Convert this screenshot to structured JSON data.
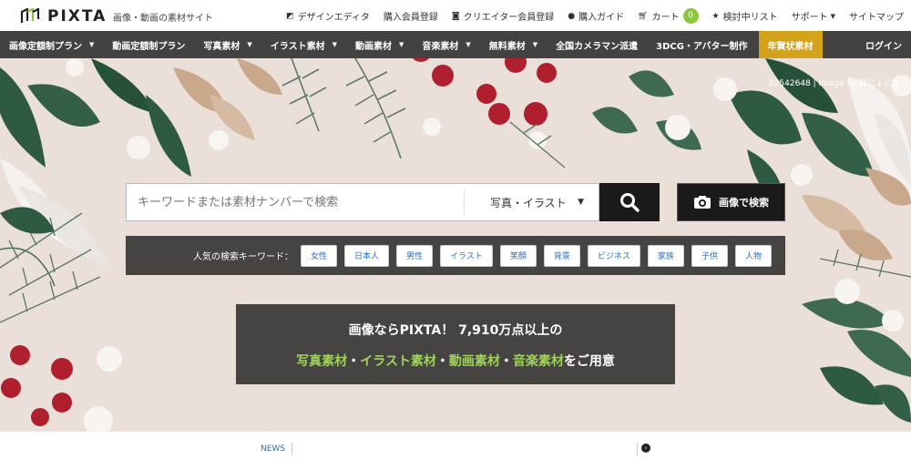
{
  "brand": {
    "logo_text": "PIXTA",
    "tagline": "画像・動画の素材サイト"
  },
  "toplinks": [
    {
      "icon": "design-editor-icon",
      "label": "デザインエディタ"
    },
    {
      "icon": "",
      "label": "購入会員登録"
    },
    {
      "icon": "camera-icon",
      "label": "クリエイター会員登録"
    },
    {
      "icon": "info-icon",
      "label": "購入ガイド"
    },
    {
      "icon": "cart-icon",
      "label": "カート"
    },
    {
      "icon": "star-icon",
      "label": "検討中リスト"
    },
    {
      "icon": "",
      "label": "サポート"
    },
    {
      "icon": "",
      "label": "サイトマップ"
    }
  ],
  "cart_count": "0",
  "nav": {
    "items": [
      {
        "label": "画像定額制プラン",
        "dropdown": true
      },
      {
        "label": "動画定額制プラン",
        "dropdown": false
      },
      {
        "label": "写真素材",
        "dropdown": true
      },
      {
        "label": "イラスト素材",
        "dropdown": true
      },
      {
        "label": "動画素材",
        "dropdown": true
      },
      {
        "label": "音楽素材",
        "dropdown": true
      },
      {
        "label": "無料素材",
        "dropdown": true
      },
      {
        "label": "全国カメラマン派遣",
        "dropdown": false
      },
      {
        "label": "3DCG・アバター制作",
        "dropdown": false
      },
      {
        "label": "年賀状素材",
        "dropdown": false
      }
    ],
    "login": "ログイン"
  },
  "hero": {
    "credit": "92542648 | Image by:ほにょじま",
    "search": {
      "placeholder": "キーワードまたは素材ナンバーで検索",
      "category": "写真・イラスト"
    },
    "image_search_label": "画像で検索",
    "keywords_label": "人気の検索キーワード：",
    "keywords": [
      "女性",
      "日本人",
      "男性",
      "イラスト",
      "笑顔",
      "背景",
      "ビジネス",
      "家族",
      "子供",
      "人物"
    ],
    "promo": {
      "line1": "画像ならPIXTA！ 7,910万点以上の",
      "line2_parts": [
        "写真素材",
        "・",
        "イラスト素材",
        "・",
        "動画素材",
        "・",
        "音楽素材",
        "をご用意"
      ]
    }
  },
  "news": {
    "label": "NEWS"
  },
  "colors": {
    "nav_bg": "#444240",
    "highlight": "#d4a21b",
    "accent_green": "#8cc63f",
    "link_blue": "#2a6ebb"
  }
}
